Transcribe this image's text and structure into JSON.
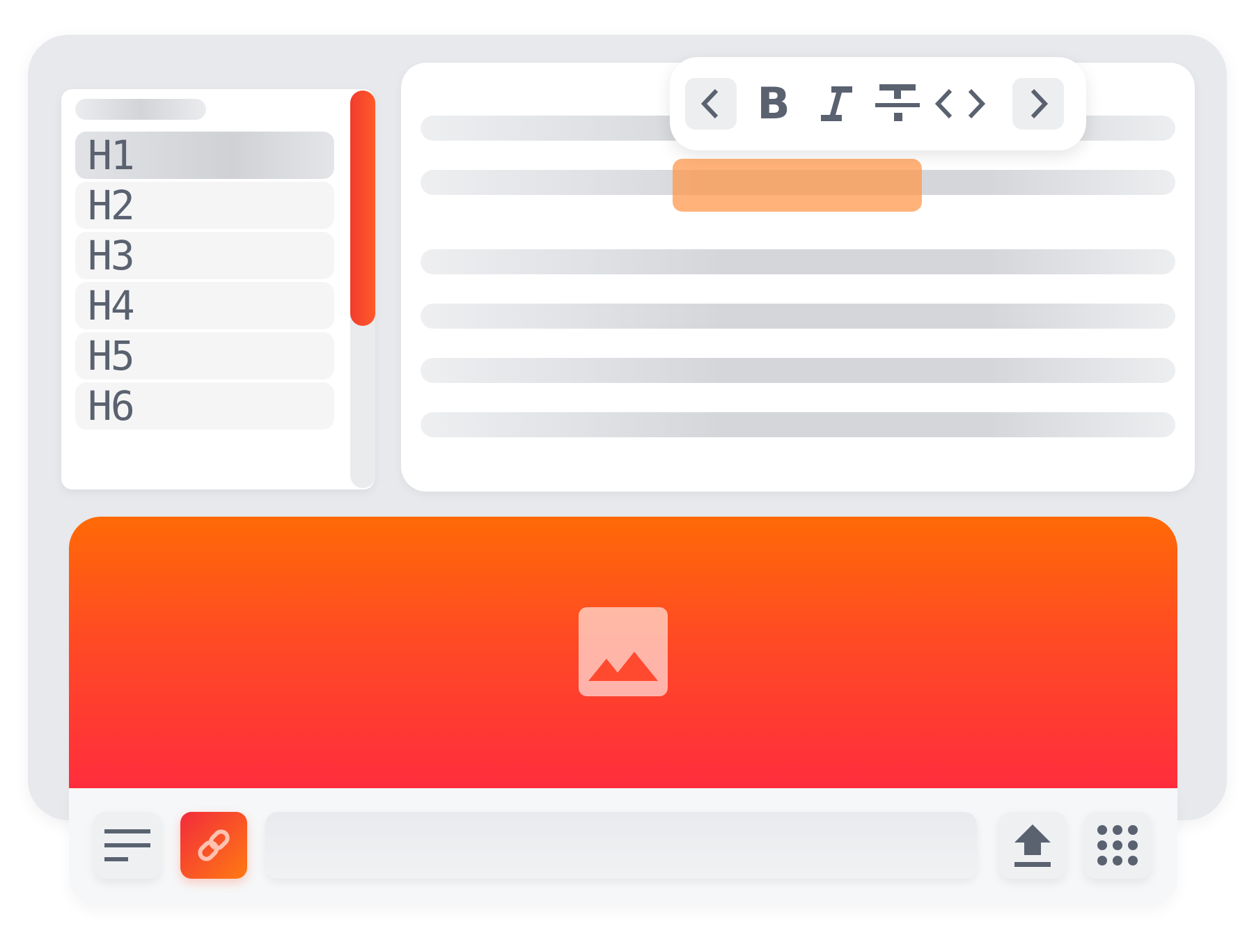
{
  "headings_panel": {
    "items": [
      {
        "label": "H1",
        "selected": true
      },
      {
        "label": "H2",
        "selected": false
      },
      {
        "label": "H3",
        "selected": false
      },
      {
        "label": "H4",
        "selected": false
      },
      {
        "label": "H5",
        "selected": false
      },
      {
        "label": "H6",
        "selected": false
      }
    ]
  },
  "format_toolbar": {
    "buttons": [
      {
        "name": "previous",
        "icon": "chevron-left-icon"
      },
      {
        "name": "bold",
        "icon": "bold-icon",
        "glyph": "B"
      },
      {
        "name": "italic",
        "icon": "italic-icon"
      },
      {
        "name": "strikethrough",
        "icon": "strikethrough-icon"
      },
      {
        "name": "code",
        "icon": "code-icon"
      },
      {
        "name": "next",
        "icon": "chevron-right-icon"
      }
    ]
  },
  "banner": {
    "icon": "image-icon"
  },
  "bottom_toolbar": {
    "buttons": [
      {
        "name": "align",
        "icon": "text-align-icon",
        "active": false
      },
      {
        "name": "link",
        "icon": "link-icon",
        "active": true
      },
      {
        "name": "upload",
        "icon": "upload-icon",
        "active": false
      },
      {
        "name": "apps",
        "icon": "grid-dots-icon",
        "active": false
      }
    ],
    "url_input": {
      "value": "",
      "placeholder": ""
    }
  },
  "colors": {
    "accent_gradient_start": "#ff6a06",
    "accent_gradient_end": "#ff2d3d",
    "selection": "#ff9646",
    "icon": "#5a6270",
    "background": "#e7e9ec"
  }
}
